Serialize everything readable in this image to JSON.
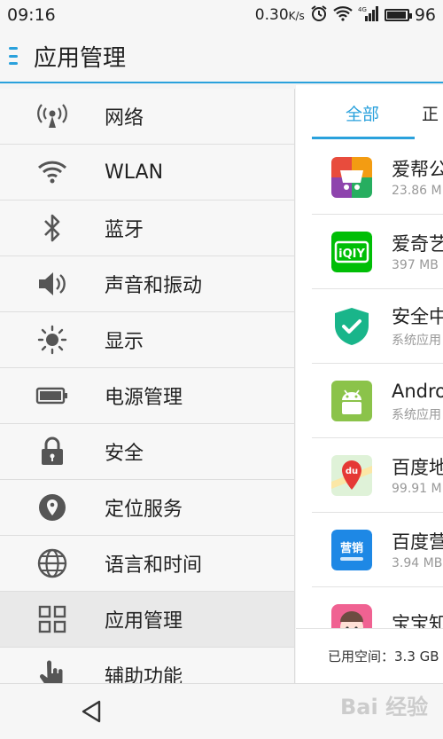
{
  "status": {
    "time": "09:16",
    "speed": "0.30",
    "speed_unit": "K/s",
    "battery": "96",
    "battery_level": 0.96,
    "network_label": "4G"
  },
  "appbar": {
    "title": "应用管理"
  },
  "settings": [
    {
      "icon": "network-icon",
      "label": "网络"
    },
    {
      "icon": "wifi-icon",
      "label": "WLAN"
    },
    {
      "icon": "bluetooth-icon",
      "label": "蓝牙"
    },
    {
      "icon": "speaker-icon",
      "label": "声音和振动"
    },
    {
      "icon": "brightness-icon",
      "label": "显示"
    },
    {
      "icon": "battery-icon",
      "label": "电源管理"
    },
    {
      "icon": "lock-icon",
      "label": "安全"
    },
    {
      "icon": "location-icon",
      "label": "定位服务"
    },
    {
      "icon": "globe-icon",
      "label": "语言和时间"
    },
    {
      "icon": "apps-grid-icon",
      "label": "应用管理",
      "selected": true
    },
    {
      "icon": "hand-pointer-icon",
      "label": "辅助功能"
    }
  ],
  "tabs": [
    {
      "label": "全部",
      "active": true
    },
    {
      "label": "正"
    }
  ],
  "apps": [
    {
      "name": "爱帮公",
      "sub": "23.86 M",
      "icon": "aibang-app-icon",
      "color": "#e84c3d"
    },
    {
      "name": "爱奇艺",
      "sub": "397 MB",
      "icon": "iqiyi-app-icon",
      "color": "#00be06"
    },
    {
      "name": "安全中",
      "sub": "系统应用",
      "icon": "security-center-app-icon",
      "color": "#19b58a"
    },
    {
      "name": "Andro",
      "sub": "系统应用",
      "icon": "android-app-icon",
      "color": "#8bc34a"
    },
    {
      "name": "百度地",
      "sub": "99.91 M",
      "icon": "baidu-map-app-icon",
      "color": "#e53935"
    },
    {
      "name": "百度营",
      "sub": "3.94 MB",
      "icon": "baidu-yingxiao-app-icon",
      "color": "#1e88e5"
    },
    {
      "name": "宝宝知",
      "sub": "",
      "icon": "baby-app-icon",
      "color": "#f06292"
    }
  ],
  "storage": {
    "label": "已用空间：",
    "value": "3.3 GB"
  },
  "watermark": {
    "text": "Bai 经验"
  },
  "colors": {
    "accent": "#2aa1dc"
  }
}
